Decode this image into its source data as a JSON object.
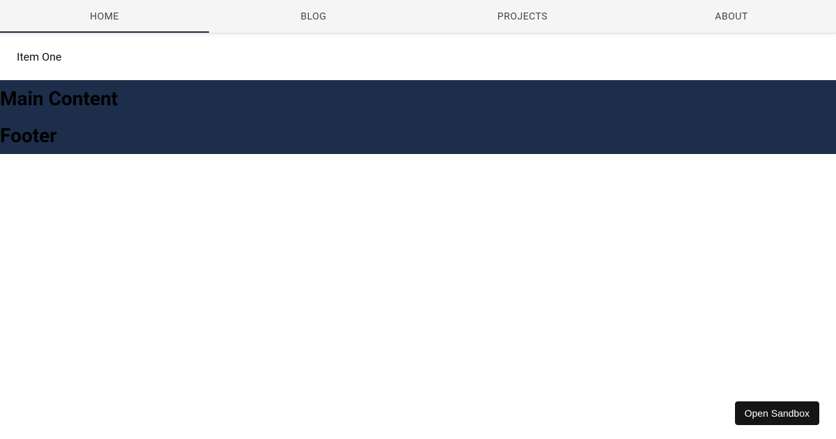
{
  "tabs": {
    "items": [
      {
        "label": "HOME"
      },
      {
        "label": "BLOG"
      },
      {
        "label": "PROJECTS"
      },
      {
        "label": "ABOUT"
      }
    ],
    "selectedIndex": 0
  },
  "panel": {
    "text": "Item One"
  },
  "main": {
    "heading": "Main Content"
  },
  "footer": {
    "heading": "Footer"
  },
  "sandbox": {
    "button_label": "Open Sandbox"
  },
  "colors": {
    "tab_bg": "#f5f5f5",
    "indicator": "#1d2e4a",
    "dark_section": "#1d2e4a",
    "sandbox_btn": "#151515"
  }
}
